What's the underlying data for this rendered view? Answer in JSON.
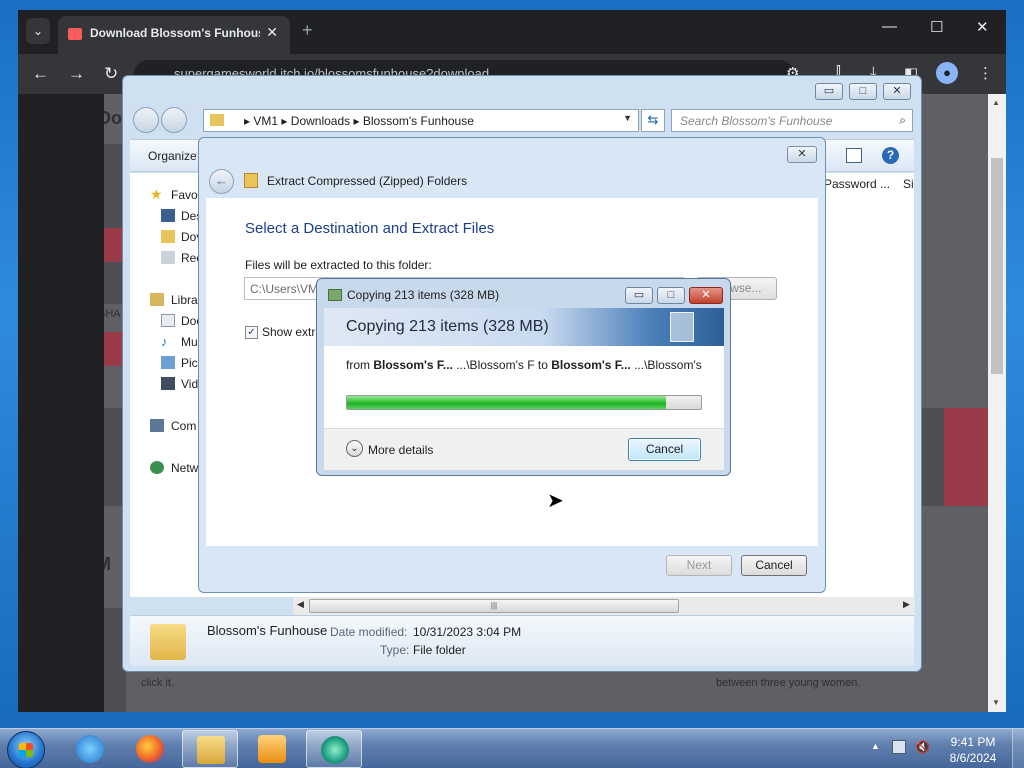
{
  "browser": {
    "tab_title": "Download Blossom's Funhouse",
    "tab_close": "✕",
    "new_tab": "+",
    "menu_glyph": "⌄",
    "url": "supergamesworld.itch.io/blossomsfunhouse?download",
    "page": {
      "heading_fragment": "Do",
      "section_fragment": "M",
      "share_fragment": "SHA",
      "footer_left": "click it.",
      "footer_right": "between three young women."
    }
  },
  "explorer": {
    "address": {
      "segments": [
        "VM1",
        "Downloads",
        "Blossom's Funhouse"
      ],
      "separator": "▸"
    },
    "search_placeholder": "Search Blossom's Funhouse",
    "organize": "Organize",
    "columns": [
      "Password ...",
      "Si"
    ],
    "nav": {
      "favorites": "Favor",
      "desktop": "Des",
      "downloads": "Dov",
      "recent": "Rec",
      "libraries": "Libra",
      "documents": "Doc",
      "music": "Mu",
      "pictures": "Pic",
      "videos": "Vid",
      "computer": "Com",
      "network": "Netw"
    },
    "details": {
      "name": "Blossom's Funhouse",
      "modified_label": "Date modified:",
      "modified_value": "10/31/2023 3:04 PM",
      "type_label": "Type:",
      "type_value": "File folder"
    }
  },
  "wizard": {
    "title": "Extract Compressed (Zipped) Folders",
    "heading": "Select a Destination and Extract Files",
    "folder_label": "Files will be extracted to this folder:",
    "path": "C:\\Users\\VM",
    "browse": "Browse...",
    "show_extracted": "Show extra",
    "next": "Next",
    "cancel": "Cancel"
  },
  "copy_dialog": {
    "title": "Copying 213 items (328 MB)",
    "banner": "Copying 213 items (328 MB)",
    "from_prefix": "from ",
    "from_name": "Blossom's F...",
    "from_path": " ...\\Blossom's F to ",
    "to_name": "Blossom's F...",
    "to_path": " ...\\Blossom's F",
    "progress_percent": 90,
    "more_details": "More details",
    "cancel": "Cancel"
  },
  "taskbar": {
    "time": "9:41 PM",
    "date": "8/6/2024"
  },
  "colors": {
    "progress_green": "#37c637",
    "wizard_heading": "#1c3f8c",
    "page_accent": "#9a3b49"
  }
}
